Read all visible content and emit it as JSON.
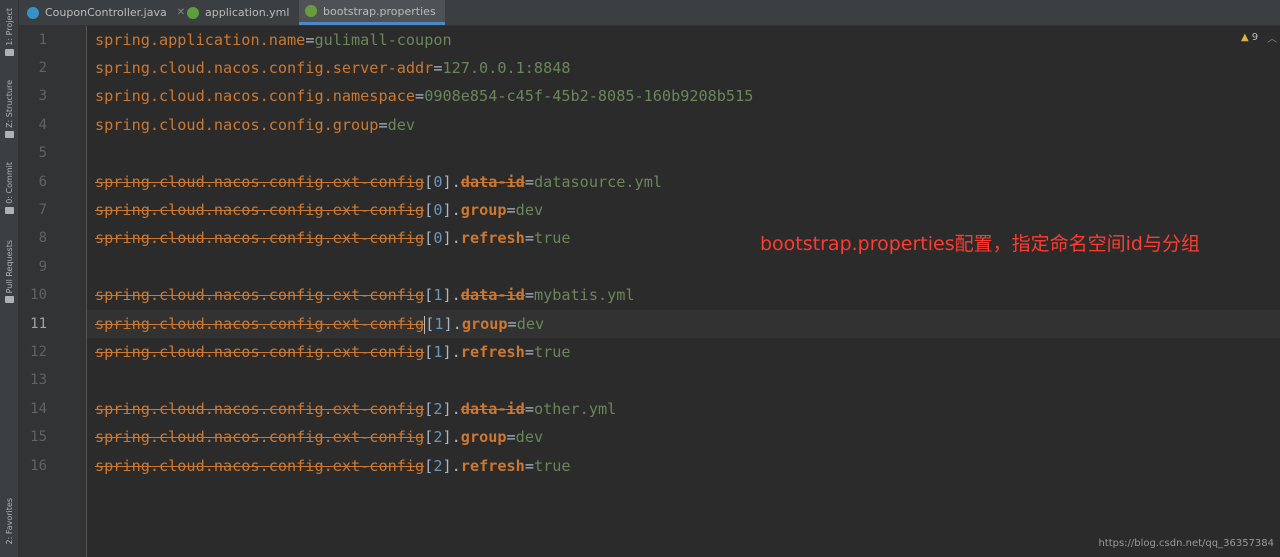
{
  "tabs": [
    {
      "label": "CouponController.java",
      "icon": "java-class-icon",
      "color": "#3592c4"
    },
    {
      "label": "application.yml",
      "icon": "yml-file-icon",
      "color": "#5c9e3c"
    },
    {
      "label": "bootstrap.properties",
      "icon": "properties-file-icon",
      "color": "#6a9c3c",
      "active": true
    }
  ],
  "left_tools": {
    "project": "1: Project",
    "structure": "Z: Structure",
    "commit": "0: Commit",
    "pull_requests": "Pull Requests",
    "favorites": "2: Favorites"
  },
  "line_numbers": [
    "1",
    "2",
    "3",
    "4",
    "5",
    "6",
    "7",
    "8",
    "9",
    "10",
    "11",
    "12",
    "13",
    "14",
    "15",
    "16"
  ],
  "current_line": 11,
  "code": {
    "l1": {
      "key": "spring.application.name",
      "val": "gulimall-coupon"
    },
    "l2": {
      "key": "spring.cloud.nacos.config.server-addr",
      "val": "127.0.0.1:8848"
    },
    "l3": {
      "key": "spring.cloud.nacos.config.namespace",
      "val": "0908e854-c45f-45b2-8085-160b9208b515"
    },
    "l4": {
      "key": "spring.cloud.nacos.config.group",
      "val": "dev"
    },
    "l6": {
      "prefix": "spring.cloud.nacos.config.ext-config",
      "idx": "0",
      "sub": "data-id",
      "val": "datasource.yml"
    },
    "l7": {
      "prefix": "spring.cloud.nacos.config.ext-config",
      "idx": "0",
      "sub": "group",
      "val": "dev"
    },
    "l8": {
      "prefix": "spring.cloud.nacos.config.ext-config",
      "idx": "0",
      "sub": "refresh",
      "val": "true"
    },
    "l10": {
      "prefix": "spring.cloud.nacos.config.ext-config",
      "idx": "1",
      "sub": "data-id",
      "val": "mybatis.yml"
    },
    "l11": {
      "prefix_a": "spring.cloud.nacos.config.ext-confi",
      "prefix_b": "g",
      "idx": "1",
      "sub": "group",
      "val": "dev"
    },
    "l12": {
      "prefix": "spring.cloud.nacos.config.ext-config",
      "idx": "1",
      "sub": "refresh",
      "val": "true"
    },
    "l14": {
      "prefix": "spring.cloud.nacos.config.ext-config",
      "idx": "2",
      "sub": "data-id",
      "val": "other.yml"
    },
    "l15": {
      "prefix": "spring.cloud.nacos.config.ext-config",
      "idx": "2",
      "sub": "group",
      "val": "dev"
    },
    "l16": {
      "prefix": "spring.cloud.nacos.config.ext-config",
      "idx": "2",
      "sub": "refresh",
      "val": "true"
    }
  },
  "annotation": "bootstrap.properties配置，指定命名空间id与分组",
  "warnings": {
    "count": "9"
  },
  "watermark": "https://blog.csdn.net/qq_36357384"
}
